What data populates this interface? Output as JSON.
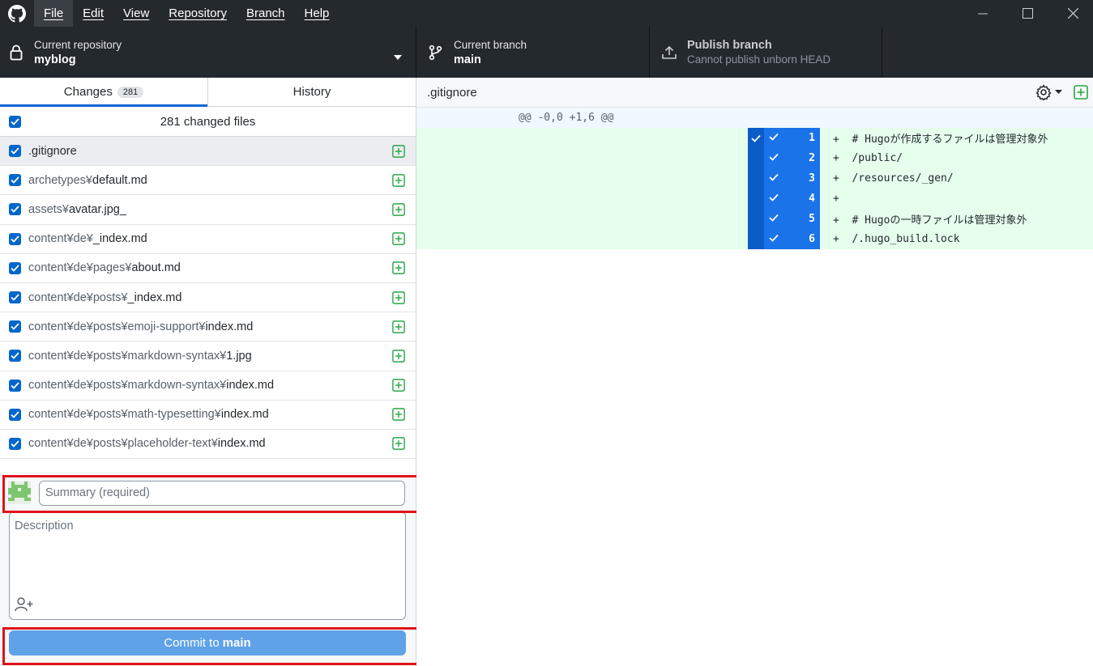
{
  "menu": {
    "items": [
      "File",
      "Edit",
      "View",
      "Repository",
      "Branch",
      "Help"
    ]
  },
  "toolbar": {
    "repository": {
      "title": "Current repository",
      "value": "myblog"
    },
    "branch": {
      "title": "Current branch",
      "value": "main"
    },
    "publish": {
      "title": "Publish branch",
      "subtitle": "Cannot publish unborn HEAD"
    }
  },
  "sidebar": {
    "tabs": {
      "changes": "Changes",
      "changes_count": "281",
      "history": "History"
    },
    "changed_files_label": "281 changed files",
    "files": [
      {
        "dir": "",
        "name": ".gitignore"
      },
      {
        "dir": "archetypes¥",
        "name": "default.md"
      },
      {
        "dir": "assets¥",
        "name": "avatar.jpg_"
      },
      {
        "dir": "content¥de¥",
        "name": "_index.md"
      },
      {
        "dir": "content¥de¥pages¥",
        "name": "about.md"
      },
      {
        "dir": "content¥de¥posts¥",
        "name": "_index.md"
      },
      {
        "dir": "content¥de¥posts¥emoji-support¥",
        "name": "index.md"
      },
      {
        "dir": "content¥de¥posts¥markdown-syntax¥",
        "name": "1.jpg"
      },
      {
        "dir": "content¥de¥posts¥markdown-syntax¥",
        "name": "index.md"
      },
      {
        "dir": "content¥de¥posts¥math-typesetting¥",
        "name": "index.md"
      },
      {
        "dir": "content¥de¥posts¥placeholder-text¥",
        "name": "index.md"
      }
    ]
  },
  "commit": {
    "summary_placeholder": "Summary (required)",
    "description_placeholder": "Description",
    "button_prefix": "Commit to",
    "button_branch": "main"
  },
  "diff": {
    "filename": ".gitignore",
    "hunk_header": "@@ -0,0 +1,6 @@",
    "lines": [
      {
        "num": "1",
        "text": "+  # Hugoが作成するファイルは管理対象外"
      },
      {
        "num": "2",
        "text": "+  /public/"
      },
      {
        "num": "3",
        "text": "+  /resources/_gen/"
      },
      {
        "num": "4",
        "text": "+"
      },
      {
        "num": "5",
        "text": "+  # Hugoの一時ファイルは管理対象外"
      },
      {
        "num": "6",
        "text": "+  /.hugo_build.lock"
      }
    ]
  },
  "colors": {
    "accent": "#0366d6",
    "checkbox": "#0066cc",
    "added_bg": "#e6ffed",
    "added_icon": "#28a745",
    "highlight": "#e0121b",
    "titlebar": "#24292e"
  }
}
